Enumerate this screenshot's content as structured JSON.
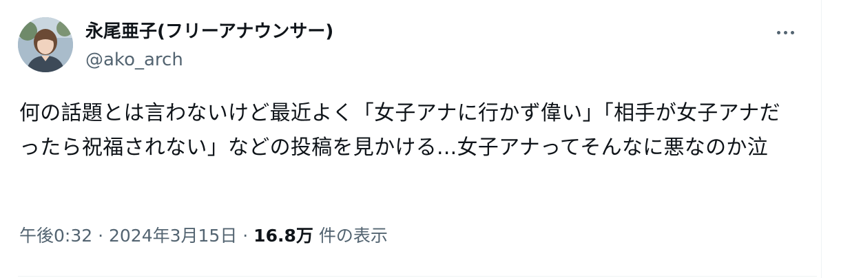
{
  "tweet": {
    "author": {
      "display_name": "永尾亜子(フリーアナウンサー)",
      "handle": "@ako_arch",
      "avatar_icon": "profile-photo"
    },
    "more_icon": "more-horizontal-icon",
    "text": "何の話題とは言わないけど最近よく「女子アナに行かず偉い」「相手が女子アナだったら祝福されない」などの投稿を見かける...女子アナってそんなに悪なのか泣",
    "time": "午後0:32",
    "separator": " · ",
    "date": "2024年3月15日",
    "views_count": "16.8万",
    "views_label": "件の表示"
  }
}
